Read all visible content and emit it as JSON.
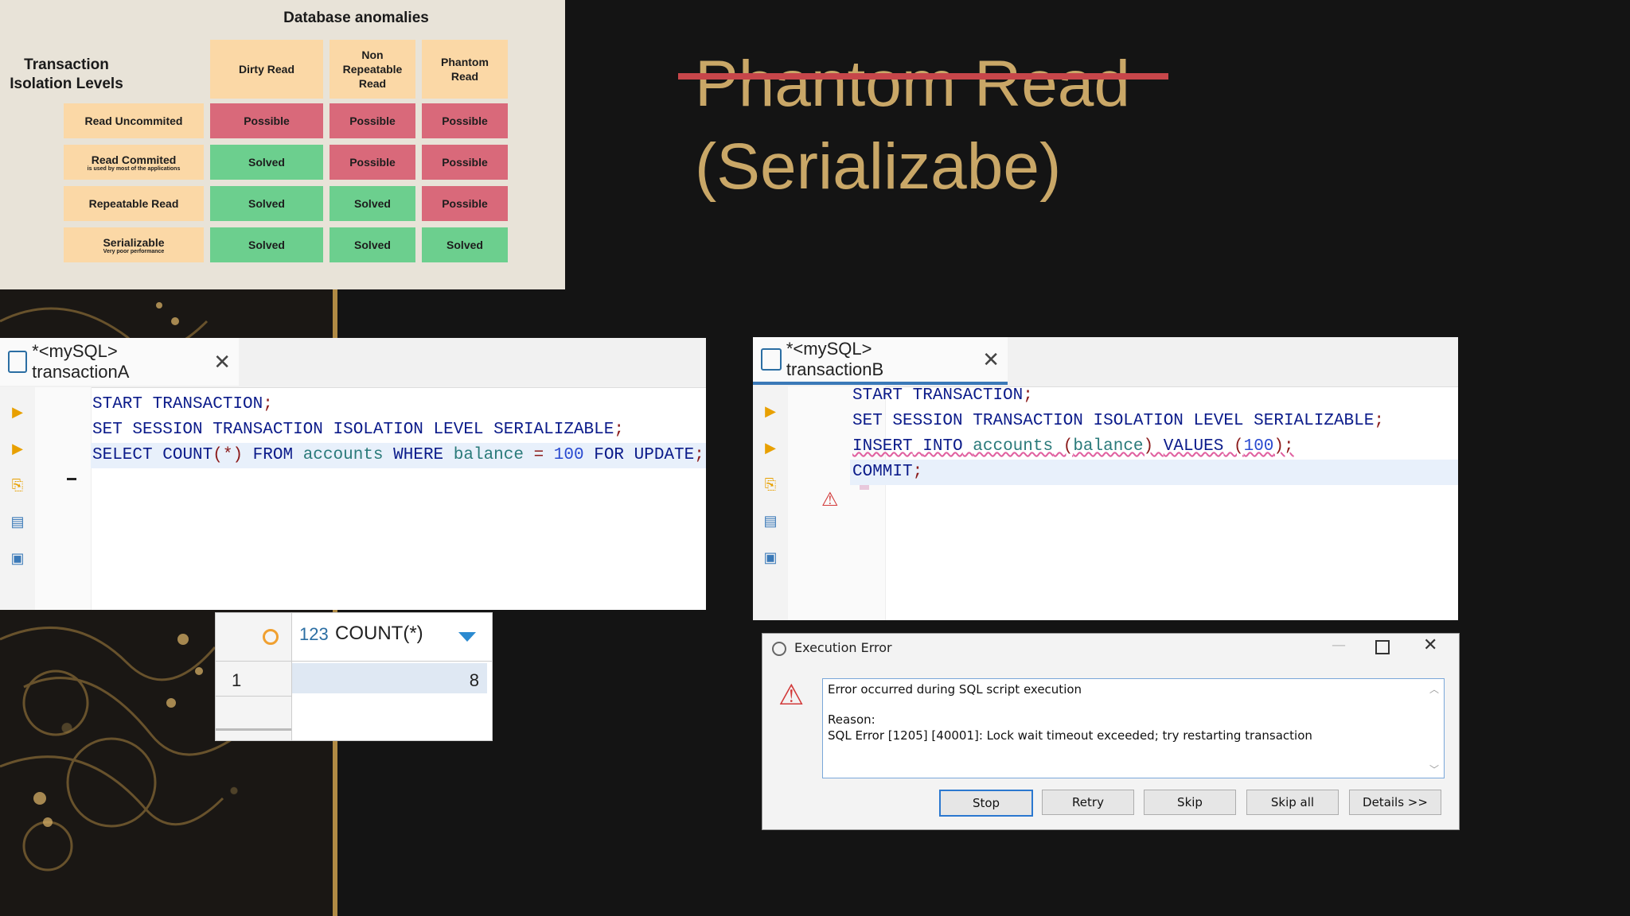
{
  "table": {
    "title": "Database anomalies",
    "corner_label_line1": "Transaction",
    "corner_label_line2": "Isolation Levels",
    "columns": [
      "Dirty Read",
      "Non Repeatable Read",
      "Phantom Read"
    ],
    "columns_lines": [
      [
        "Dirty Read"
      ],
      [
        "Non",
        "Repeatable",
        "Read"
      ],
      [
        "Phantom",
        "Read"
      ]
    ],
    "rows": [
      {
        "label": "Read Uncommited",
        "note": "",
        "values": [
          "Possible",
          "Possible",
          "Possible"
        ]
      },
      {
        "label": "Read Commited",
        "note": "is used by most of the applications",
        "values": [
          "Solved",
          "Possible",
          "Possible"
        ]
      },
      {
        "label": "Repeatable Read",
        "note": "",
        "values": [
          "Solved",
          "Solved",
          "Possible"
        ]
      },
      {
        "label": "Serializable",
        "note": "Very poor performance",
        "values": [
          "Solved",
          "Solved",
          "Solved"
        ]
      }
    ],
    "colors": {
      "possible": "#d9697a",
      "solved": "#6ccf8e",
      "header": "#fbd8a6"
    }
  },
  "slide": {
    "title_struck": "Phantom Read",
    "subtitle": "(Serializabe)",
    "accent_color": "#c9a767",
    "strike_color": "#c7464a"
  },
  "editorA": {
    "tab_title": "*<mySQL> transactionA",
    "line1": "START TRANSACTION;",
    "line2": "SET SESSION TRANSACTION ISOLATION LEVEL SERIALIZABLE;",
    "line3": "SELECT COUNT(*) FROM accounts WHERE balance = 100 FOR UPDATE;"
  },
  "editorB": {
    "tab_title": "*<mySQL> transactionB",
    "line1": "START TRANSACTION;",
    "line2": "SET SESSION TRANSACTION ISOLATION LEVEL SERIALIZABLE;",
    "line3": "INSERT INTO accounts (balance) VALUES (100);",
    "line4": "COMMIT;"
  },
  "result_grid": {
    "column_type": "123",
    "column_name": "COUNT(*)",
    "row_number": "1",
    "value": "8"
  },
  "error_dialog": {
    "title": "Execution Error",
    "message_line1": "Error occurred during SQL script execution",
    "reason_label": "Reason:",
    "reason_text": "SQL Error [1205] [40001]: Lock wait timeout exceeded; try restarting transaction",
    "buttons": [
      "Stop",
      "Retry",
      "Skip",
      "Skip all",
      "Details >>"
    ]
  }
}
